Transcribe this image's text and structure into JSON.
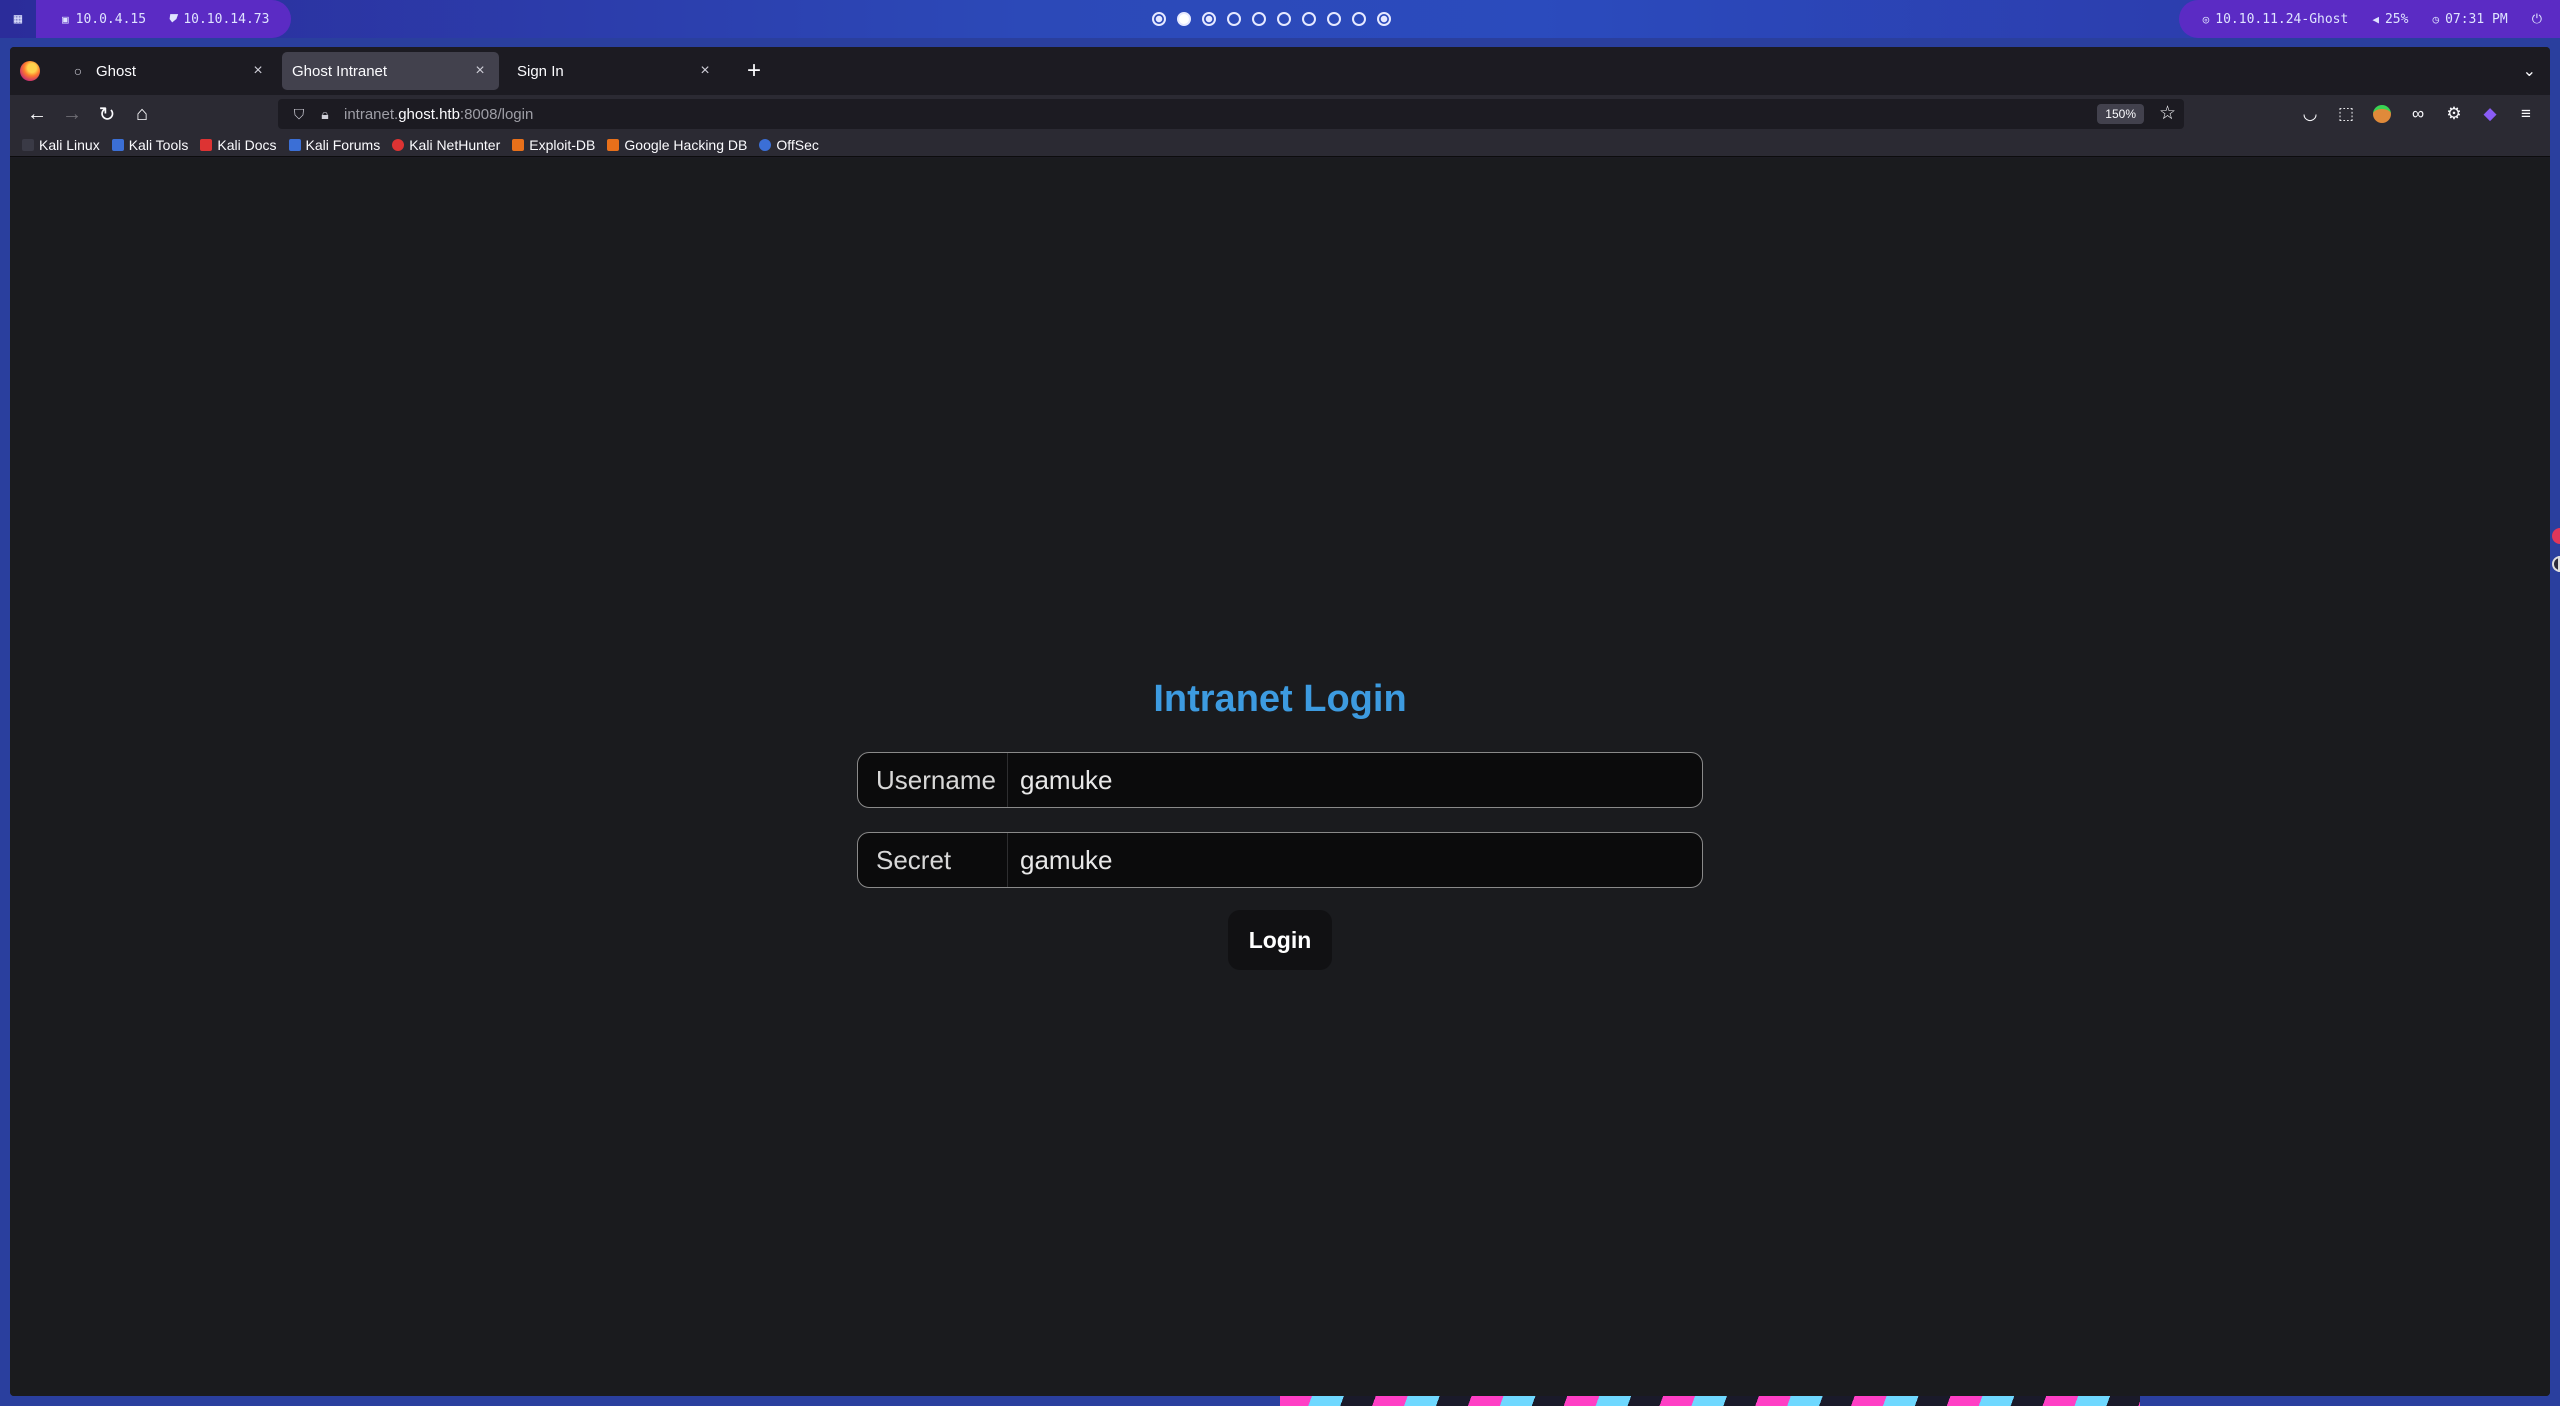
{
  "desktop": {
    "ip_local": "10.0.4.15",
    "ip_vpn": "10.10.14.73",
    "target": "10.10.11.24-Ghost",
    "volume": "25%",
    "time": "07:31 PM"
  },
  "browser": {
    "tabs": [
      {
        "title": "Ghost",
        "active": false
      },
      {
        "title": "Ghost Intranet",
        "active": true
      },
      {
        "title": "Sign In",
        "active": false
      }
    ],
    "url_prefix": "intranet.",
    "url_host": "ghost.htb",
    "url_suffix": ":8008/login",
    "zoom": "150%",
    "bookmarks": [
      {
        "label": "Kali Linux",
        "color": "#3b6fd6"
      },
      {
        "label": "Kali Tools",
        "color": "#3b6fd6"
      },
      {
        "label": "Kali Docs",
        "color": "#d33"
      },
      {
        "label": "Kali Forums",
        "color": "#3b6fd6"
      },
      {
        "label": "Kali NetHunter",
        "color": "#d33"
      },
      {
        "label": "Exploit-DB",
        "color": "#e8701a"
      },
      {
        "label": "Google Hacking DB",
        "color": "#e8701a"
      },
      {
        "label": "OffSec",
        "color": "#3b6fd6"
      }
    ]
  },
  "login": {
    "title": "Intranet Login",
    "username_label": "Username",
    "username_value": "gamuke",
    "secret_label": "Secret",
    "secret_value": "gamuke",
    "button": "Login"
  }
}
